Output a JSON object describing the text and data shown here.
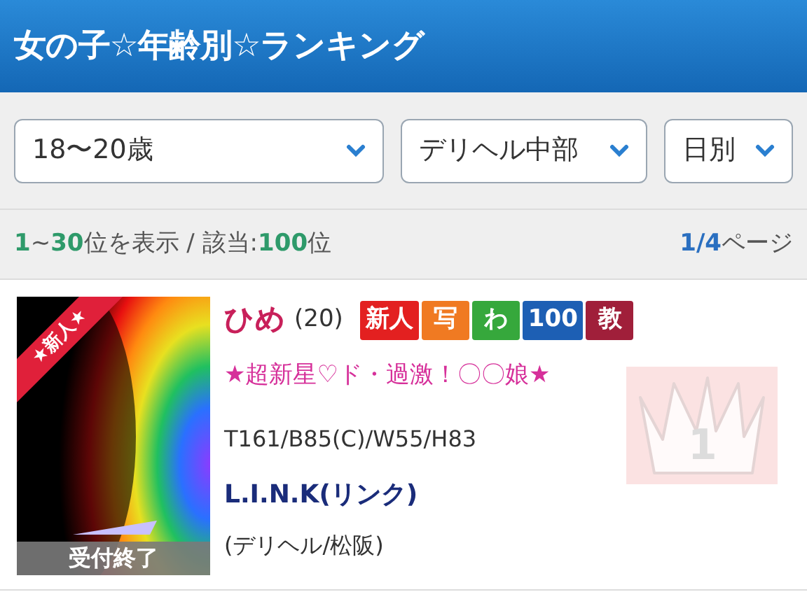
{
  "header": {
    "title": "女の子☆年齢別☆ランキング"
  },
  "filters": [
    {
      "value": "18〜20歳"
    },
    {
      "value": "デリヘル中部"
    },
    {
      "value": "日別"
    }
  ],
  "summary": {
    "segments": [
      {
        "text": "1",
        "highlight": true
      },
      {
        "text": "~",
        "highlight": false
      },
      {
        "text": "30",
        "highlight": true
      },
      {
        "text": "位を表示 / 該当:",
        "highlight": false
      },
      {
        "text": "100",
        "highlight": true
      },
      {
        "text": "位",
        "highlight": false
      }
    ],
    "page": {
      "current": "1/4",
      "suffix": "ページ"
    }
  },
  "entries": [
    {
      "photo": {
        "kind": "picture",
        "ribbon": "★新人★",
        "overlay": "受付終了"
      },
      "name": "ひめ",
      "age": "(20)",
      "badges": [
        {
          "label": "新人",
          "color": "#e32020"
        },
        {
          "label": "写",
          "color": "#f07a22"
        },
        {
          "label": "わ",
          "color": "#36a83c"
        },
        {
          "label": "100",
          "color": "#1d5fb4"
        },
        {
          "label": "教",
          "color": "#a01f3a"
        }
      ],
      "catchphrase": "★超新星♡ド・過激！〇〇娘★",
      "measurements": "T161/B85(C)/W55/H83",
      "shop": "L.I.N.K(リンク)",
      "area": "(デリヘル/松阪)",
      "rank": "1"
    }
  ]
}
